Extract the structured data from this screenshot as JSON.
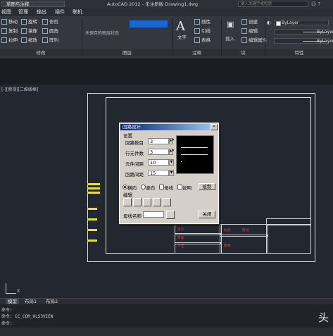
{
  "titlebar": {
    "workspace": "草图与注释",
    "app_title": "AutoCAD 2012 - 未注册版    Drawing1.dwg",
    "search_placeholder": "键入关键字或短语"
  },
  "menubar": [
    "视图",
    "管理",
    "输出",
    "插件",
    "联机"
  ],
  "ribbon": {
    "modify_tools": [
      "移动",
      "旋转",
      "修剪",
      "复制",
      "镜像",
      "圆角",
      "拉伸",
      "缩放",
      "阵列"
    ],
    "layer_state": "未保存的图层状态",
    "annotation": {
      "text_label": "文字",
      "tools": [
        "线性",
        "引线",
        "表格"
      ]
    },
    "block": {
      "insert_label": "插入",
      "tools": [
        "创建",
        "编辑",
        "编辑属性"
      ]
    },
    "properties": {
      "values": [
        "ByLayer",
        "ByLayer",
        "ByLayer"
      ]
    },
    "panel_labels": [
      "修改",
      "图层",
      "注释",
      "块",
      "特性"
    ],
    "accent_blue": "#1668d6"
  },
  "viewport": {
    "label": "[-][俯视][二维线框]",
    "title_block_text": [
      "设计",
      "审核",
      "工艺",
      "比例",
      "图号",
      "数量"
    ]
  },
  "dialog": {
    "title": "回路设计",
    "section_settings": "设置",
    "fields": [
      {
        "label": "回路数目",
        "value": "3"
      },
      {
        "label": "行元件数",
        "value": "3"
      },
      {
        "label": "元件间距",
        "value": "10"
      },
      {
        "label": "回路间距",
        "value": "15"
      }
    ],
    "options": {
      "horizontal": "横向",
      "vertical": "竖向",
      "busbar": "母线",
      "note": "说明"
    },
    "draw_button": "绘制",
    "section_edit": "编辑",
    "busbar_name_label": "母线名称",
    "busbar_name_value": "",
    "close_button": "关闭"
  },
  "tabs": [
    "模型",
    "布局1",
    "布局2"
  ],
  "command": {
    "line1": "命令:",
    "line2": "命令: CC_COM_HLS3VIEW",
    "line3": "命令:"
  }
}
